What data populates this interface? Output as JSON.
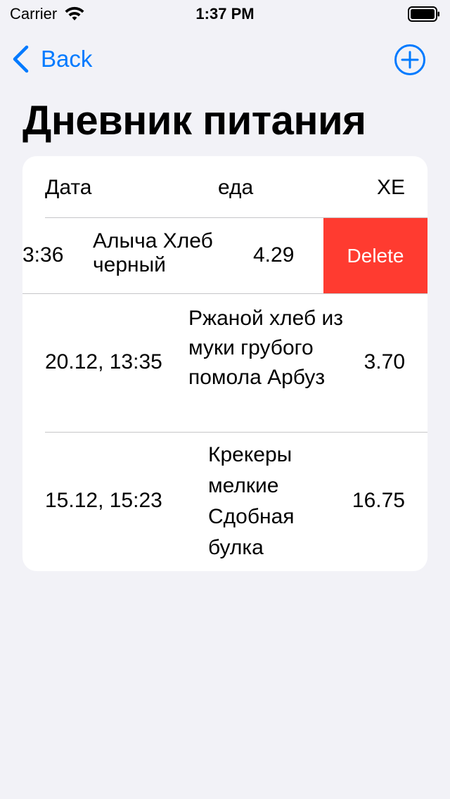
{
  "status_bar": {
    "carrier": "Carrier",
    "time": "1:37 PM"
  },
  "nav": {
    "back_label": "Back"
  },
  "title": "Дневник питания",
  "table": {
    "headers": {
      "date": "Дата",
      "food": "еда",
      "xe": "ХЕ"
    },
    "rows": [
      {
        "date": "3:36",
        "food": "Алыча Хлеб черный",
        "xe": "4.29",
        "action": "Delete"
      },
      {
        "date": "20.12, 13:35",
        "food": "Ржаной хлеб из муки грубого помола Арбуз",
        "xe": "3.70"
      },
      {
        "date": "15.12, 15:23",
        "food": "Крекеры мелкие Сдобная булка",
        "xe": "16.75"
      }
    ]
  },
  "colors": {
    "accent": "#007aff",
    "destructive": "#ff3b30",
    "background": "#f2f2f7"
  },
  "icons": {
    "back": "chevron-left-icon",
    "add": "plus-circle-icon",
    "wifi": "wifi-icon",
    "battery": "battery-icon"
  }
}
